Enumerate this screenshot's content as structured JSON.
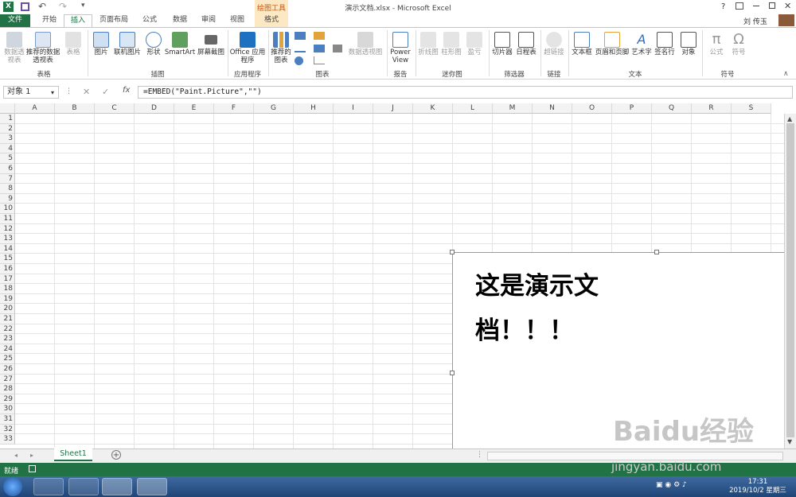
{
  "window": {
    "title": "演示文档.xlsx - Microsoft Excel",
    "user": "刘 传玉",
    "help": "?"
  },
  "context_tab": {
    "group": "绘图工具",
    "label": "格式"
  },
  "tabs": [
    "文件",
    "开始",
    "插入",
    "页面布局",
    "公式",
    "数据",
    "审阅",
    "视图"
  ],
  "ribbon": {
    "groups": [
      {
        "name": "表格",
        "buttons": [
          "数据透视表",
          "推荐的数据透视表",
          "表格"
        ]
      },
      {
        "name": "插图",
        "buttons": [
          "图片",
          "联机图片",
          "形状",
          "SmartArt",
          "屏幕截图"
        ]
      },
      {
        "name": "应用程序",
        "buttons": [
          "Office 应用程序"
        ]
      },
      {
        "name": "图表",
        "buttons": [
          "推荐的图表",
          "数据透视图"
        ]
      },
      {
        "name": "报告",
        "buttons": [
          "Power View"
        ]
      },
      {
        "name": "迷你图",
        "buttons": [
          "折线图",
          "柱形图",
          "盈亏"
        ]
      },
      {
        "name": "筛选器",
        "buttons": [
          "切片器",
          "日程表"
        ]
      },
      {
        "name": "链接",
        "buttons": [
          "超链接"
        ]
      },
      {
        "name": "文本",
        "buttons": [
          "文本框",
          "页眉和页脚",
          "艺术字",
          "签名行",
          "对象"
        ]
      },
      {
        "name": "符号",
        "buttons": [
          "公式",
          "符号"
        ]
      }
    ]
  },
  "formula_bar": {
    "name_box": "对象 1",
    "fx": "fx",
    "formula": "=EMBED(\"Paint.Picture\",\"\")"
  },
  "columns": [
    "A",
    "B",
    "C",
    "D",
    "E",
    "F",
    "G",
    "H",
    "I",
    "J",
    "K",
    "L",
    "M",
    "N",
    "O",
    "P",
    "Q",
    "R",
    "S"
  ],
  "rows": [
    "1",
    "2",
    "3",
    "4",
    "5",
    "6",
    "7",
    "8",
    "9",
    "10",
    "11",
    "12",
    "13",
    "14",
    "15",
    "16",
    "17",
    "18",
    "19",
    "20",
    "21",
    "22",
    "23",
    "24",
    "25",
    "26",
    "27",
    "28",
    "29",
    "30",
    "31",
    "32",
    "33"
  ],
  "embedded_object": {
    "line1": "这是演示文",
    "line2": "档！！！"
  },
  "sheets": {
    "active": "Sheet1",
    "add": "+"
  },
  "status": {
    "ready": "就绪"
  },
  "taskbar": {
    "time": "17:31",
    "date": "2019/10/2 星期三"
  },
  "watermark": {
    "logo": "Baidu经验",
    "url": "jingyan.baidu.com"
  },
  "colors": {
    "excel_green": "#217346",
    "context_orange": "#c45911"
  }
}
